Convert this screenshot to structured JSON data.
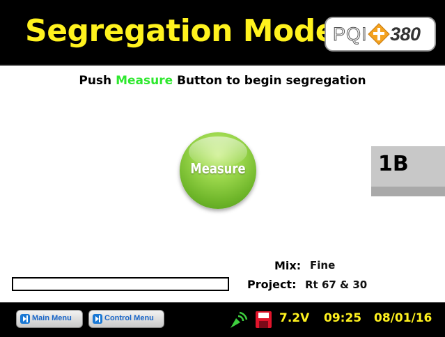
{
  "header": {
    "title": "Segregation Mode",
    "logo": {
      "left_text": "PQI",
      "right_text": "380",
      "diamond_color": "#f4a21e"
    }
  },
  "instruction": {
    "prefix": "Push",
    "highlight": "Measure",
    "suffix": "Button to begin segregation",
    "highlight_color": "#2ee82e"
  },
  "measure_button": {
    "label": "Measure",
    "color": "#6fb62a"
  },
  "segment": {
    "label": "1B"
  },
  "info": {
    "mix_label": "Mix:",
    "mix_value": "Fine",
    "project_label": "Project:",
    "project_value": "Rt 67 & 30"
  },
  "progress": {
    "value": 0
  },
  "footer": {
    "main_menu_label": "Main Menu",
    "control_menu_label": "Control Menu",
    "battery": "7.2V",
    "time": "09:25",
    "date": "08/01/16",
    "status_color": "#fff21e",
    "icons": [
      "signal-icon",
      "save-icon",
      "main-menu-icon",
      "control-menu-icon"
    ]
  }
}
